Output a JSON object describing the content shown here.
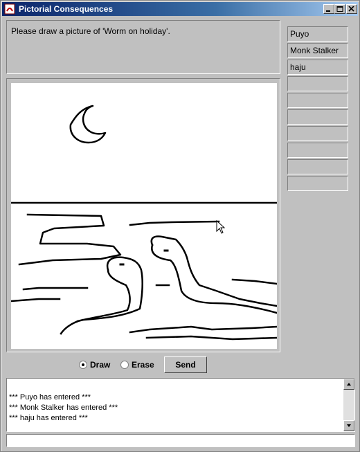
{
  "window": {
    "title": "Pictorial Consequences"
  },
  "prompt": {
    "text": "Please draw a picture of 'Worm on holiday'."
  },
  "players": [
    "Puyo",
    "Monk Stalker",
    "haju",
    "",
    "",
    "",
    "",
    "",
    "",
    ""
  ],
  "controls": {
    "draw_label": "Draw",
    "erase_label": "Erase",
    "send_label": "Send",
    "selected_mode": "Draw"
  },
  "chat": {
    "messages": [
      "*** Puyo has entered ***",
      "*** Monk Stalker has entered ***",
      "*** haju has entered ***"
    ]
  },
  "input": {
    "value": ""
  },
  "icons": {
    "app": "app-icon",
    "minimize": "minimize-icon",
    "maximize": "maximize-icon",
    "close": "close-icon",
    "pointer": "mouse-pointer-icon"
  }
}
